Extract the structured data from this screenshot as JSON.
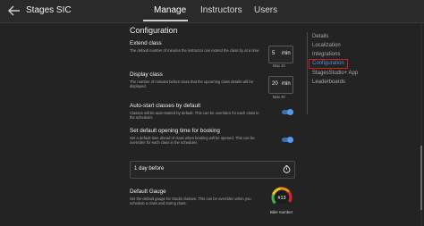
{
  "header": {
    "app_title": "Stages SIC",
    "tabs": [
      {
        "label": "Manage",
        "active": true
      },
      {
        "label": "Instructors",
        "active": false
      },
      {
        "label": "Users",
        "active": false
      }
    ]
  },
  "section_title": "Configuration",
  "settings": {
    "extend_class": {
      "title": "Extend class",
      "description": "The default number of minutes the instructor can extend the class by at a time.",
      "value": "5",
      "unit": "min",
      "max": "Max 10"
    },
    "display_class": {
      "title": "Display class",
      "description": "The number of minutes before class that the upcoming class details will be displayed.",
      "value": "20",
      "unit": "min",
      "max": "Max 30"
    },
    "auto_start": {
      "title": "Auto-start classes by default",
      "description": "Classes will be auto-started by default. This can be overriden for each class in the scheduler.",
      "enabled": true
    },
    "booking_opening": {
      "title": "Set default opening time for booking",
      "description": "Set a default time ahead of class when booking will be opened. This can be overriden for each class in the scheduler.",
      "enabled": true,
      "selected_value": "1 day before"
    },
    "default_gauge": {
      "title": "Default Gauge",
      "description": "Set the default gauge for Studio classes. This can be overriden when you schedule a class and during class.",
      "gauge_value": "#13",
      "gauge_label": "Bike number"
    }
  },
  "sidenav": {
    "items": [
      {
        "label": "Details",
        "active": false
      },
      {
        "label": "Localization",
        "active": false
      },
      {
        "label": "Integrations",
        "active": false
      },
      {
        "label": "Configuration",
        "active": true
      },
      {
        "label": "StagesStudio+ App",
        "active": false
      },
      {
        "label": "Leaderboards",
        "active": false
      }
    ]
  },
  "colors": {
    "background": "#232323",
    "accent": "#4f8fe0",
    "highlight_box": "#d21e1e"
  }
}
